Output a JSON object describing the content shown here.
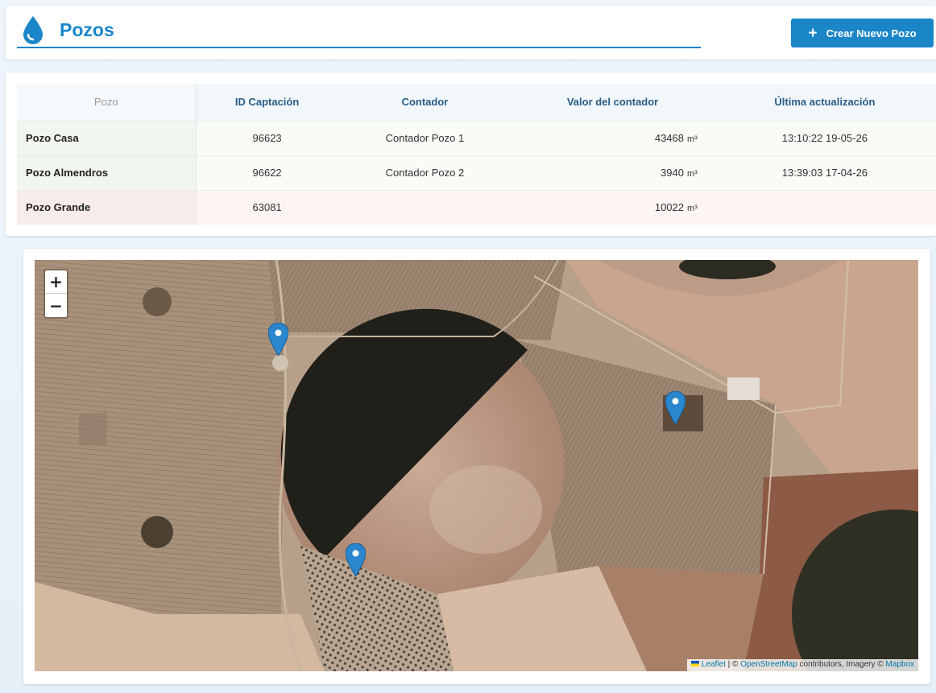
{
  "header": {
    "title": "Pozos",
    "create_button_label": "Crear Nuevo Pozo",
    "icon": "water-drop-icon"
  },
  "table": {
    "columns": [
      "Pozo",
      "ID Captación",
      "Contador",
      "Valor del contador",
      "Última actualización"
    ],
    "rows": [
      {
        "name": "Pozo Casa",
        "id": "96623",
        "meter": "Contador Pozo 1",
        "value": "43468",
        "unit": "m³",
        "updated": "13:10:22 19-05-26",
        "status": "ok"
      },
      {
        "name": "Pozo Almendros",
        "id": "96622",
        "meter": "Contador Pozo 2",
        "value": "3940",
        "unit": "m³",
        "updated": "13:39:03 17-04-26",
        "status": "ok"
      },
      {
        "name": "Pozo Grande",
        "id": "63081",
        "meter": "",
        "value": "10022",
        "unit": "m³",
        "updated": "",
        "status": "warn"
      }
    ]
  },
  "map": {
    "zoom_in": "+",
    "zoom_out": "−",
    "markers": [
      "map-marker-pozo-1",
      "map-marker-pozo-2",
      "map-marker-pozo-3"
    ],
    "attribution": {
      "leaflet": "Leaflet",
      "sep1": " | © ",
      "osm": "OpenStreetMap",
      "mid": " contributors, Imagery © ",
      "mapbox": "Mapbox"
    }
  },
  "colors": {
    "primary": "#1a86c8",
    "row_ok": "#f9fcf6",
    "row_warn": "#fdf5f4"
  }
}
